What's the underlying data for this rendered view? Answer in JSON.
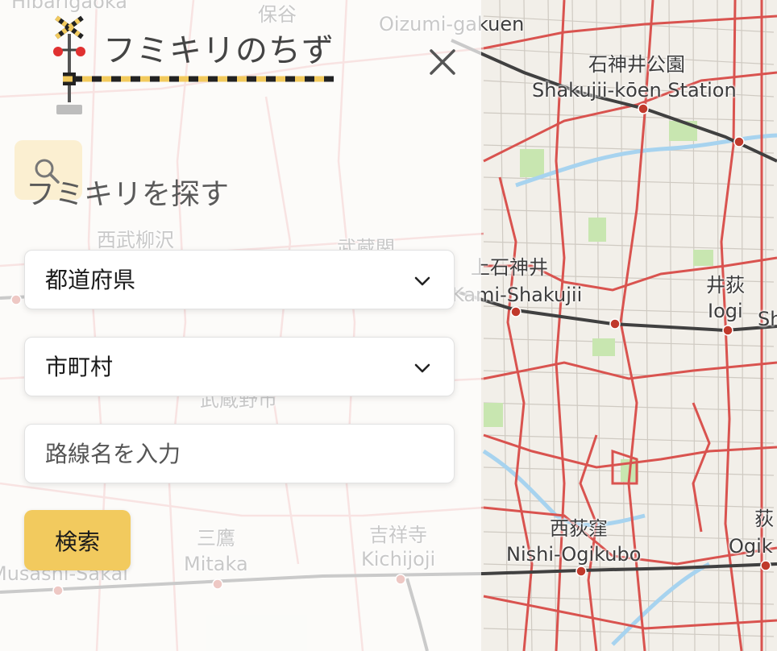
{
  "app": {
    "logo_text": "フミキリのちず"
  },
  "panel": {
    "section_title": "フミキリを探す",
    "prefecture_select": {
      "label": "都道府県"
    },
    "city_select": {
      "label": "市町村"
    },
    "line_input": {
      "placeholder": "路線名を入力",
      "value": ""
    },
    "search_button": "検索"
  },
  "map": {
    "labels": {
      "hibarigaoka": "Hibarigaoka",
      "hoya": "保谷",
      "oizumi_gakuen": "Oizumi-gakuen",
      "shakujii_koen_jp": "石神井公園",
      "shakujii_koen_en": "Shakujii-kōen Station",
      "nishi_yanagisawa": "西武柳沢",
      "musashino_top": "武蔵関",
      "kami_shakujii_jp": "上石神井",
      "kami_shakujii_en": "Kami-Shakujii",
      "iogi_jp": "井荻",
      "iogi_en": "Iogi",
      "shimo_igusa_partial": "Sh",
      "musashino_city": "武蔵野市",
      "nishi_ogikubo_jp": "西荻窪",
      "nishi_ogikubo_en": "Nishi-Ogikubo",
      "ogikubo_jp_partial": "荻",
      "ogikubo_en_partial": "Ogik",
      "mitaka_jp": "三鷹",
      "mitaka_en": "Mitaka",
      "kichijoji_jp": "吉祥寺",
      "kichijoji_en": "Kichijoji",
      "musashi_sakai_en": "Musashi-Sakai"
    }
  },
  "colors": {
    "accent": "#f2ca5e",
    "road_red": "#d9534f",
    "rail": "#404040",
    "park_green": "#c8e6b0",
    "water_blue": "#a7d3ef"
  }
}
